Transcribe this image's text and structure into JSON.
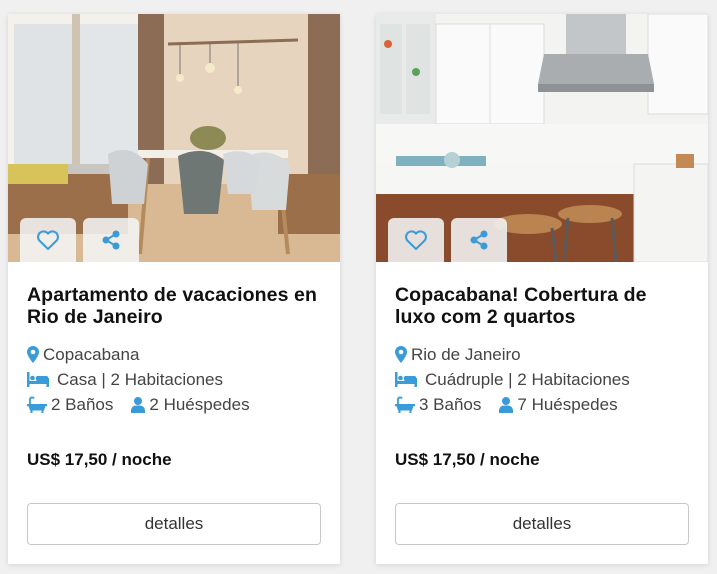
{
  "colors": {
    "accent": "#3a9bd9",
    "title": "#111111",
    "text": "#444444"
  },
  "listings": [
    {
      "title": "Apartamento de vacaciones en Rio de Janeiro",
      "location": "Copacabana",
      "type_rooms": "Casa | 2 Habitaciones",
      "baths": "2 Baños",
      "guests": "2 Huéspedes",
      "price": "US$ 17,50 / noche",
      "details_label": "detalles",
      "image": "dining-room-photo"
    },
    {
      "title": "Copacabana! Cobertura de luxo com 2 quartos",
      "location": "Rio de Janeiro",
      "type_rooms": "Cuádruple | 2 Habitaciones",
      "baths": "3 Baños",
      "guests": "7 Huéspedes",
      "price": "US$ 17,50 / noche",
      "details_label": "detalles",
      "image": "kitchen-photo"
    }
  ]
}
